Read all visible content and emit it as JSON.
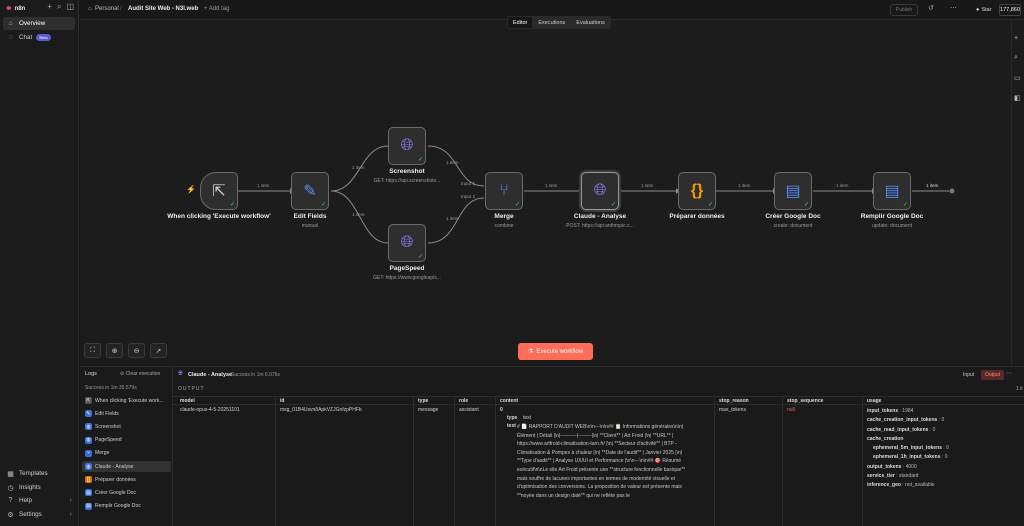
{
  "app": {
    "logo_text": "n8n"
  },
  "sidebar": {
    "items": [
      {
        "label": "Overview",
        "icon": "home-icon"
      },
      {
        "label": "Chat",
        "icon": "chat-icon",
        "badge": "Beta"
      }
    ],
    "bottom": [
      {
        "label": "Templates",
        "icon": "templates-icon"
      },
      {
        "label": "Insights",
        "icon": "insights-icon"
      },
      {
        "label": "Help",
        "icon": "help-icon"
      },
      {
        "label": "Settings",
        "icon": "settings-icon"
      }
    ]
  },
  "topbar": {
    "project": "Personal",
    "separator": "/",
    "workflow_name": "Audit Site Web - N3I.web",
    "add_tag": "+ Add tag",
    "publish": "Publish",
    "star_label": "Star",
    "star_count": "177,860"
  },
  "tabs": [
    "Editor",
    "Executions",
    "Evaluations"
  ],
  "nodes": {
    "trigger": {
      "title": "When clicking 'Execute workflow'",
      "sub": ""
    },
    "edit_fields": {
      "title": "Edit Fields",
      "sub": "manual"
    },
    "screenshot": {
      "title": "Screenshot",
      "sub": "GET: https://api.screenshoto..."
    },
    "pagespeed": {
      "title": "PageSpeed",
      "sub": "GET: https://www.googleapis..."
    },
    "merge": {
      "title": "Merge",
      "sub": "combine"
    },
    "claude": {
      "title": "Claude - Analyse",
      "sub": "POST: https://api.anthropic.c..."
    },
    "preparer": {
      "title": "Préparer données",
      "sub": ""
    },
    "creer_doc": {
      "title": "Créer Google Doc",
      "sub": "create: document"
    },
    "remplir_doc": {
      "title": "Remplir Google Doc",
      "sub": "update: document"
    }
  },
  "edge_labels": {
    "trigger_edit": "1 item",
    "edit_screenshot": "1 item",
    "edit_pagespeed": "1 item",
    "screenshot_merge": "1 item",
    "pagespeed_merge": "1 item",
    "merge_input1": "Input 1",
    "merge_input2": "Input 2",
    "merge_claude": "1 item",
    "claude_preparer": "1 item",
    "preparer_creer": "1 item",
    "creer_remplir": "1 item",
    "remplir_out": "1 item"
  },
  "execute_button": "Execute workflow",
  "logs": {
    "title": "Logs",
    "clear": "Clear execution",
    "status": "Success in 1m 35.579s",
    "items": [
      {
        "label": "When clicking 'Execute work...",
        "icon": "pointer-icon",
        "color": "#555555"
      },
      {
        "label": "Edit Fields",
        "icon": "pencil-icon",
        "color": "#3b6fd6"
      },
      {
        "label": "Screenshot",
        "icon": "globe-icon",
        "color": "#3b6fd6"
      },
      {
        "label": "PageSpeed",
        "icon": "globe-icon",
        "color": "#3b6fd6"
      },
      {
        "label": "Merge",
        "icon": "merge-icon",
        "color": "#3b6fd6"
      },
      {
        "label": "Claude - Analyse",
        "icon": "globe-icon",
        "color": "#3b6fd6"
      },
      {
        "label": "Préparer données",
        "icon": "code-icon",
        "color": "#d97706"
      },
      {
        "label": "Créer Google Doc",
        "icon": "doc-icon",
        "color": "#3b6fd6"
      },
      {
        "label": "Remplir Google Doc",
        "icon": "doc-icon",
        "color": "#3b6fd6"
      }
    ],
    "detail": {
      "node": "Claude - Analyse",
      "status": "Success in 1m 6.976s",
      "input_label": "Input",
      "output_label": "Output",
      "section": "OUTPUT",
      "page_count": "1 it",
      "columns": [
        "model",
        "id",
        "type",
        "role",
        "content",
        "stop_reason",
        "stop_sequence",
        "usage"
      ],
      "row": {
        "model": "claude-opus-4-5-20251101",
        "id": "msg_01B4Usvn8ApkVZJGnfzpPHFb",
        "type": "message",
        "role": "assistant",
        "content_index": "0",
        "content_type_key": "type",
        "content_type_val": "text",
        "content_text_key": "text",
        "content_text": "# 📄 RAPPORT D'AUDIT WEB\\n\\n---\\n\\n## 📋 Informations générales\\n\\n| Élément | Détail |\\n|----------|--------|\\n| **Client** | Art Froid |\\n| **URL** | https://www.artfroid-climatisation-tarn.fr/ |\\n| **Secteur d'activité** | BTP - Climatisation & Pompes à chaleur |\\n| **Date de l'audit** | Janvier 2025 |\\n| **Type d'audit** | Analyse UX/UI et Performance |\\n\\n---\\n\\n## 🎯 Résumé exécutif\\n\\nLe site Art Froid présente une **structure fonctionnelle basique** mais souffre de lacunes importantes en termes de modernité visuelle et d'optimisation des conversions. La proposition de valeur est présente mais **noyée dans un design daté** qui ne reflète pas le",
        "stop_reason": "max_tokens",
        "stop_sequence": "null",
        "usage": [
          {
            "key": "input_tokens",
            "val": "1984",
            "indent": 0
          },
          {
            "key": "cache_creation_input_tokens",
            "val": "0",
            "indent": 0
          },
          {
            "key": "cache_read_input_tokens",
            "val": "0",
            "indent": 0
          },
          {
            "key": "cache_creation",
            "val": "",
            "indent": 0
          },
          {
            "key": "ephemeral_5m_input_tokens",
            "val": "0",
            "indent": 1
          },
          {
            "key": "ephemeral_1h_input_tokens",
            "val": "0",
            "indent": 1
          },
          {
            "key": "output_tokens",
            "val": "4000",
            "indent": 0
          },
          {
            "key": "service_tier",
            "val": "standard",
            "indent": 0
          },
          {
            "key": "inference_geo",
            "val": "not_available",
            "indent": 0
          }
        ]
      }
    }
  },
  "colors": {
    "accent": "#ff6d5a",
    "success": "#37b24d",
    "brand": "#ea4b71"
  }
}
